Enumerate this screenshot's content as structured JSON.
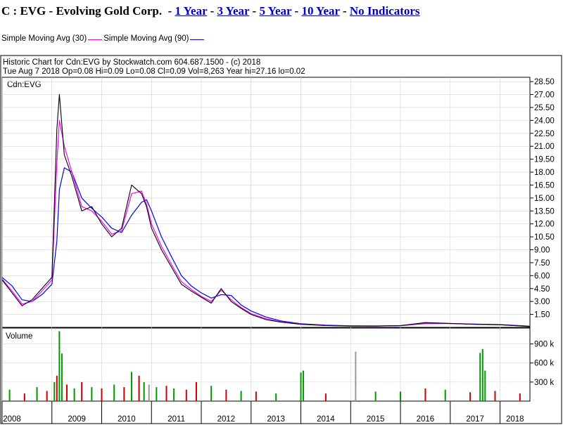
{
  "header": {
    "title": "C : EVG - Evolving Gold Corp.",
    "links": [
      "1 Year",
      "3 Year",
      "5 Year",
      "10 Year",
      "No Indicators"
    ]
  },
  "indicators": [
    {
      "name": "Simple Moving Avg (30)",
      "color": "#ff00ff"
    },
    {
      "name": "Simple Moving Avg (90)",
      "color": "#0000ff"
    }
  ],
  "chart_info": {
    "line1": "Historic Chart for Cdn:EVG by Stockwatch.com 604.687.1500 - (c) 2018",
    "line2": "Tue Aug  7 2018   Op=0.08  Hi=0.09  Lo=0.08  Cl=0.09  Vol=8,263   Year hi=27.16   lo=0.02",
    "symbol": "Cdn:EVG",
    "volume_label": "Volume"
  },
  "chart_data": [
    {
      "type": "line",
      "symbol": "Cdn:EVG",
      "x": [
        "2008.0",
        "2008.2",
        "2008.4",
        "2008.6",
        "2008.8",
        "2009.0",
        "2009.1",
        "2009.15",
        "2009.25",
        "2009.4",
        "2009.6",
        "2009.8",
        "2010.0",
        "2010.2",
        "2010.4",
        "2010.6",
        "2010.8",
        "2010.9",
        "2011.0",
        "2011.2",
        "2011.4",
        "2011.6",
        "2011.8",
        "2012.0",
        "2012.2",
        "2012.4",
        "2012.6",
        "2012.8",
        "2013.0",
        "2013.3",
        "2013.6",
        "2014.0",
        "2014.5",
        "2015.0",
        "2015.5",
        "2016.0",
        "2016.5",
        "2017.0",
        "2017.5",
        "2018.0",
        "2018.6"
      ],
      "series": [
        {
          "name": "Cdn:EVG",
          "color": "#000000",
          "values": [
            5.5,
            4.0,
            2.5,
            3.2,
            4.5,
            5.8,
            23.0,
            27.0,
            20.0,
            17.5,
            13.5,
            14.0,
            12.0,
            10.5,
            11.5,
            16.5,
            15.5,
            14.0,
            11.5,
            9.0,
            7.0,
            5.0,
            4.2,
            3.5,
            2.8,
            4.5,
            3.0,
            2.2,
            1.5,
            0.9,
            0.6,
            0.35,
            0.2,
            0.15,
            0.15,
            0.2,
            0.55,
            0.45,
            0.35,
            0.3,
            0.1
          ]
        },
        {
          "name": "Simple Moving Avg (30)",
          "color": "#ff00ff",
          "values": [
            5.6,
            4.2,
            2.7,
            3.0,
            4.2,
            5.5,
            19.0,
            24.0,
            21.0,
            18.0,
            14.0,
            13.5,
            12.3,
            10.8,
            11.2,
            15.5,
            15.8,
            14.3,
            12.0,
            9.4,
            7.3,
            5.3,
            4.4,
            3.6,
            3.0,
            4.3,
            3.2,
            2.3,
            1.6,
            1.0,
            0.65,
            0.38,
            0.22,
            0.16,
            0.15,
            0.2,
            0.5,
            0.45,
            0.36,
            0.3,
            0.12
          ]
        },
        {
          "name": "Simple Moving Avg (90)",
          "color": "#0000ff",
          "values": [
            5.8,
            4.8,
            3.2,
            3.0,
            3.8,
            5.0,
            10.0,
            16.0,
            18.5,
            18.0,
            15.0,
            13.8,
            12.8,
            11.5,
            11.0,
            13.0,
            14.5,
            14.8,
            13.5,
            10.5,
            8.2,
            6.0,
            4.8,
            4.0,
            3.4,
            3.8,
            3.7,
            2.6,
            1.9,
            1.2,
            0.75,
            0.42,
            0.25,
            0.18,
            0.16,
            0.19,
            0.45,
            0.45,
            0.38,
            0.32,
            0.15
          ]
        }
      ],
      "yticks": [
        "28.50",
        "27.00",
        "25.50",
        "24.00",
        "22.50",
        "21.00",
        "19.50",
        "18.00",
        "16.50",
        "15.00",
        "13.50",
        "12.00",
        "10.50",
        "9.00",
        "7.50",
        "6.00",
        "4.50",
        "3.00",
        "1.50"
      ],
      "ylim": [
        0,
        29
      ],
      "xticks": [
        "2008",
        "2009",
        "2010",
        "2011",
        "2012",
        "2013",
        "2014",
        "2015",
        "2016",
        "2017",
        "2018"
      ],
      "xlim": [
        2008.0,
        2018.6
      ],
      "grid": true
    },
    {
      "type": "bar",
      "title": "Volume",
      "x": [
        2008.15,
        2008.45,
        2008.7,
        2008.9,
        2009.05,
        2009.1,
        2009.15,
        2009.2,
        2009.3,
        2009.45,
        2009.6,
        2009.8,
        2010.0,
        2010.25,
        2010.45,
        2010.6,
        2010.75,
        2010.85,
        2010.95,
        2011.1,
        2011.3,
        2011.45,
        2011.7,
        2011.9,
        2012.2,
        2012.5,
        2012.8,
        2013.1,
        2013.5,
        2014.0,
        2014.05,
        2014.5,
        2015.1,
        2015.5,
        2016.0,
        2016.5,
        2016.9,
        2017.4,
        2017.6,
        2017.65,
        2017.7,
        2017.9,
        2018.4
      ],
      "values": [
        180,
        120,
        220,
        160,
        300,
        400,
        1100,
        750,
        260,
        200,
        300,
        220,
        200,
        260,
        220,
        460,
        400,
        300,
        260,
        220,
        240,
        200,
        180,
        300,
        240,
        180,
        160,
        150,
        120,
        450,
        480,
        120,
        780,
        150,
        150,
        200,
        180,
        140,
        760,
        820,
        480,
        160,
        120
      ],
      "colors": [
        "#009900",
        "#cc0000",
        "#009900",
        "#cc0000",
        "#009900",
        "#cc0000",
        "#009900",
        "#009900",
        "#cc0000",
        "#009900",
        "#cc0000",
        "#009900",
        "#cc0000",
        "#009900",
        "#cc0000",
        "#009900",
        "#cc0000",
        "#009900",
        "#999999",
        "#009900",
        "#cc0000",
        "#009900",
        "#cc0000",
        "#cc0000",
        "#009900",
        "#cc0000",
        "#009900",
        "#cc0000",
        "#009900",
        "#009900",
        "#009900",
        "#cc0000",
        "#999999",
        "#009900",
        "#009900",
        "#cc0000",
        "#009900",
        "#cc0000",
        "#009900",
        "#009900",
        "#009900",
        "#cc0000",
        "#cc0000"
      ],
      "yticks": [
        "900 k",
        "600 k",
        "300 k"
      ],
      "ylim": [
        0,
        1150
      ]
    }
  ]
}
